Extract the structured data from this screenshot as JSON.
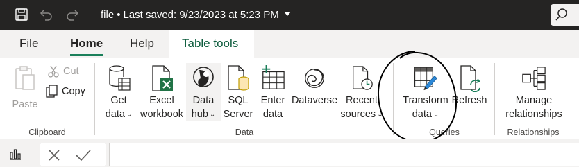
{
  "titlebar": {
    "file_name": "file",
    "separator": "•",
    "last_saved": "Last saved: 9/23/2023 at 5:23 PM"
  },
  "tabs": [
    {
      "label": "File"
    },
    {
      "label": "Home"
    },
    {
      "label": "Help"
    },
    {
      "label": "Table tools"
    }
  ],
  "active_tab": "Home",
  "clipboard": {
    "paste": "Paste",
    "cut": "Cut",
    "copy": "Copy",
    "group": "Clipboard"
  },
  "data": {
    "get_data": [
      "Get",
      "data"
    ],
    "excel": [
      "Excel",
      "workbook"
    ],
    "data_hub": [
      "Data",
      "hub"
    ],
    "sql": [
      "SQL",
      "Server"
    ],
    "enter": [
      "Enter",
      "data"
    ],
    "dataverse": "Dataverse",
    "recent": [
      "Recent",
      "sources"
    ],
    "group": "Data"
  },
  "queries": {
    "transform": [
      "Transform",
      "data"
    ],
    "refresh": "Refresh",
    "group": "Queries"
  },
  "relationships": {
    "manage": [
      "Manage",
      "relationships"
    ],
    "group": "Relationships"
  },
  "colors": {
    "titlebar": "#252423",
    "accent": "#1a7f5a",
    "excel_green": "#217346",
    "transform_blue": "#2b88d8"
  },
  "icons": [
    "save-icon",
    "undo-icon",
    "redo-icon",
    "dropdown-caret-icon",
    "search-icon",
    "paste-icon",
    "cut-icon",
    "copy-icon",
    "get-data-icon",
    "excel-icon",
    "data-hub-icon",
    "sql-server-icon",
    "enter-data-icon",
    "dataverse-icon",
    "recent-sources-icon",
    "transform-data-icon",
    "refresh-icon",
    "manage-relationships-icon",
    "report-view-icon",
    "cancel-icon",
    "commit-icon"
  ]
}
